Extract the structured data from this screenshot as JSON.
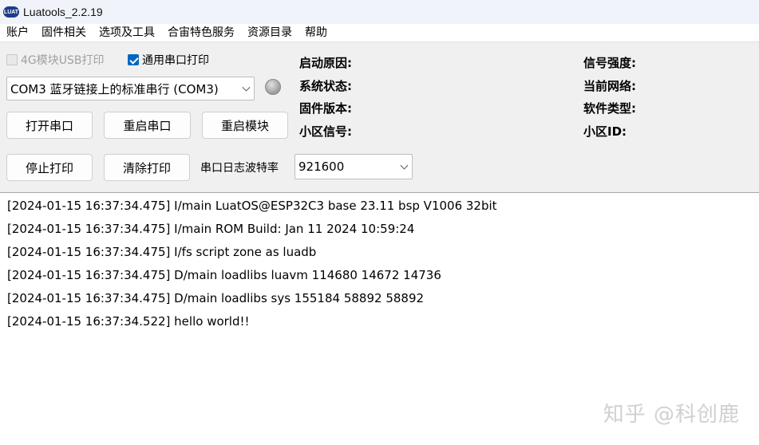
{
  "window": {
    "title": "Luatools_2.2.19",
    "icon_text": "LUAT"
  },
  "menu": [
    "账户",
    "固件相关",
    "选项及工具",
    "合宙特色服务",
    "资源目录",
    "帮助"
  ],
  "options": {
    "usb_print_4g": {
      "label": "4G模块USB打印",
      "checked": false,
      "disabled": true
    },
    "serial_print": {
      "label": "通用串口打印",
      "checked": true
    }
  },
  "port_select": {
    "value": "COM3 蓝牙链接上的标准串行 (COM3)"
  },
  "buttons": {
    "open_port": "打开串口",
    "restart_port": "重启串口",
    "restart_module": "重启模块",
    "stop_print": "停止打印",
    "clear_print": "清除打印"
  },
  "baud": {
    "label": "串口日志波特率",
    "value": "921600"
  },
  "status": {
    "boot_reason": "启动原因:",
    "system_state": "系统状态:",
    "firmware_version": "固件版本:",
    "cell_signal": "小区信号:",
    "signal_strength": "信号强度:",
    "current_network": "当前网络:",
    "software_type": "软件类型:",
    "cell_id": "小区ID:"
  },
  "log": [
    "[2024-01-15 16:37:34.475] I/main LuatOS@ESP32C3 base 23.11 bsp V1006 32bit",
    "[2024-01-15 16:37:34.475] I/main ROM Build: Jan 11 2024 10:59:24",
    "[2024-01-15 16:37:34.475] I/fs script zone as luadb",
    "[2024-01-15 16:37:34.475] D/main loadlibs luavm 114680 14672 14736",
    "[2024-01-15 16:37:34.475] D/main loadlibs sys   155184 58892 58892",
    "[2024-01-15 16:37:34.522] hello world!!"
  ],
  "watermark": "知乎 @科创鹿"
}
